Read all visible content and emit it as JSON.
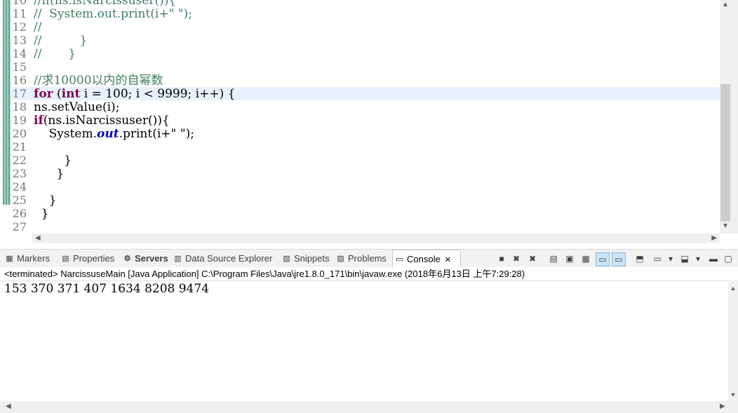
{
  "editor": {
    "lines": [
      {
        "num": "10",
        "parts": [
          {
            "t": "//if(ns.isNarcissuser()){",
            "c": "cm"
          }
        ]
      },
      {
        "num": "11",
        "parts": [
          {
            "t": "//  System.out.print(i+\" \");",
            "c": "cm"
          }
        ]
      },
      {
        "num": "12",
        "parts": [
          {
            "t": "//",
            "c": "cm"
          }
        ]
      },
      {
        "num": "13",
        "parts": [
          {
            "t": "//          }",
            "c": "cm"
          }
        ]
      },
      {
        "num": "14",
        "parts": [
          {
            "t": "//       }",
            "c": "cm"
          }
        ]
      },
      {
        "num": "15",
        "parts": []
      },
      {
        "num": "16",
        "parts": [
          {
            "t": "//求10000以内的自幂数",
            "c": "cm"
          }
        ]
      },
      {
        "num": "17",
        "parts": [
          {
            "t": "for",
            "c": "kw"
          },
          {
            "t": " (",
            "c": ""
          },
          {
            "t": "int",
            "c": "kw"
          },
          {
            "t": " i = 100; i < 9999; i++) {",
            "c": ""
          }
        ]
      },
      {
        "num": "18",
        "parts": [
          {
            "t": "ns.setValue(i);",
            "c": ""
          }
        ]
      },
      {
        "num": "19",
        "parts": [
          {
            "t": "if",
            "c": "kw"
          },
          {
            "t": "(ns.isNarcissuser()){",
            "c": ""
          }
        ]
      },
      {
        "num": "20",
        "parts": [
          {
            "t": "    System.",
            "c": ""
          },
          {
            "t": "out",
            "c": "fld"
          },
          {
            "t": ".print(i+\" \");",
            "c": ""
          }
        ]
      },
      {
        "num": "21",
        "parts": []
      },
      {
        "num": "22",
        "parts": [
          {
            "t": "        }",
            "c": ""
          }
        ]
      },
      {
        "num": "23",
        "parts": [
          {
            "t": "      }",
            "c": ""
          }
        ]
      },
      {
        "num": "24",
        "parts": []
      },
      {
        "num": "25",
        "parts": [
          {
            "t": "    }",
            "c": ""
          }
        ]
      },
      {
        "num": "26",
        "parts": [
          {
            "t": "  }",
            "c": ""
          }
        ]
      },
      {
        "num": "27",
        "parts": []
      }
    ]
  },
  "views": {
    "tabs": [
      {
        "label": "Markers",
        "icon": "markers-icon",
        "glyph": "▦"
      },
      {
        "label": "Properties",
        "icon": "properties-icon",
        "glyph": "▤"
      },
      {
        "label": "Servers",
        "icon": "servers-icon",
        "glyph": "⚙"
      },
      {
        "label": "Data Source Explorer",
        "icon": "data-source-icon",
        "glyph": "▥"
      },
      {
        "label": "Snippets",
        "icon": "snippets-icon",
        "glyph": "▧"
      },
      {
        "label": "Problems",
        "icon": "problems-icon",
        "glyph": "▨"
      },
      {
        "label": "Console",
        "icon": "console-icon",
        "glyph": "▭"
      }
    ],
    "active_tab": "Console",
    "close_glyph": "✕"
  },
  "console": {
    "status": "<terminated> NarcissuseMain [Java Application] C:\\Program Files\\Java\\jre1.8.0_171\\bin\\javaw.exe (2018年6月13日 上午7:29:28)",
    "output": "153 370 371 407 1634 8208 9474"
  },
  "colors": {
    "keyword": "#7f0055",
    "comment": "#3f7f5f",
    "field": "#0000c0",
    "current_line": "#e8f2fe"
  }
}
